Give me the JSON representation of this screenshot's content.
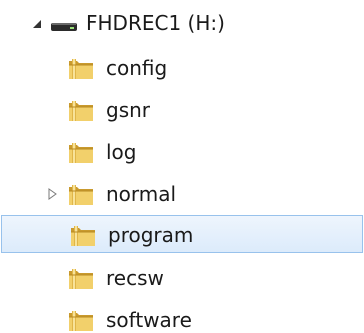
{
  "tree": {
    "drive": {
      "label": "FHDREC1 (H:)",
      "expanded": true,
      "icon": "drive-icon"
    },
    "folders": [
      {
        "label": "config",
        "icon": "folder-icon",
        "expander": "none",
        "selected": false
      },
      {
        "label": "gsnr",
        "icon": "folder-icon",
        "expander": "none",
        "selected": false
      },
      {
        "label": "log",
        "icon": "folder-icon",
        "expander": "none",
        "selected": false
      },
      {
        "label": "normal",
        "icon": "folder-icon",
        "expander": "collapsed",
        "selected": false
      },
      {
        "label": "program",
        "icon": "folder-icon",
        "expander": "none",
        "selected": true
      },
      {
        "label": "recsw",
        "icon": "folder-icon",
        "expander": "none",
        "selected": false
      },
      {
        "label": "software",
        "icon": "folder-icon",
        "expander": "none",
        "selected": false
      }
    ]
  },
  "colors": {
    "selection_fill": "#dcebfb",
    "selection_border": "#98c2ec",
    "folder_yellow": "#e8c24a"
  }
}
